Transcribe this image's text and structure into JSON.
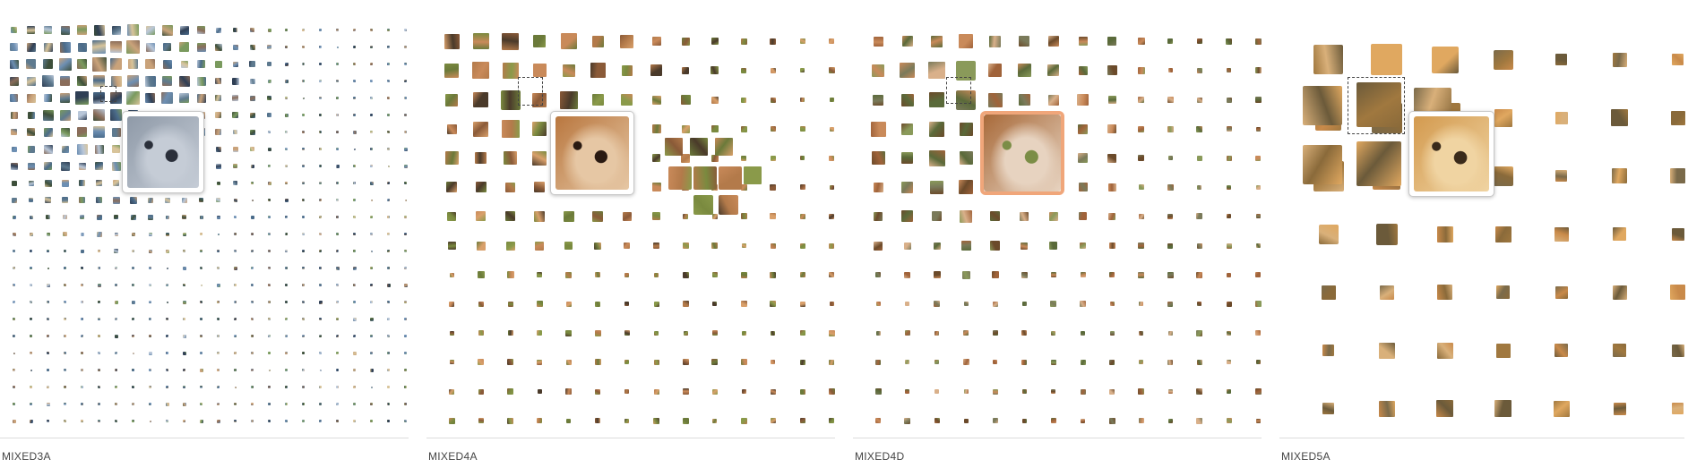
{
  "panels": [
    {
      "label": "MIXED3A",
      "palette": [
        "#4a6b8a",
        "#6d8fb3",
        "#c9a27a",
        "#8a6d5a",
        "#3d4f3a",
        "#7a9a5e",
        "#b9c7d9",
        "#2f3f55",
        "#d8c49a",
        "#5e7a8f"
      ],
      "zoom_colors": [
        "#8f9aa8",
        "#c5ccd6",
        "#2a2f3a"
      ],
      "highlight": false
    },
    {
      "label": "MIXED4A",
      "palette": [
        "#b37a4a",
        "#8a5a38",
        "#d9a06b",
        "#6b7a3a",
        "#8a9a4a",
        "#4a3a2a",
        "#c98a5a",
        "#7a8a3f"
      ],
      "zoom_colors": [
        "#b9773f",
        "#e6c7a4",
        "#2a1a12"
      ],
      "highlight": false
    },
    {
      "label": "MIXED4D",
      "palette": [
        "#a0633a",
        "#c98a5a",
        "#5a6a3a",
        "#8a9a5a",
        "#d9b08a",
        "#6b4a2a",
        "#7a7a5a"
      ],
      "zoom_colors": [
        "#a86a3a",
        "#e7d3c0",
        "#7b8d46"
      ],
      "highlight": true
    },
    {
      "label": "MIXED5A",
      "palette": [
        "#c98a4a",
        "#e0a860",
        "#8a6a3a",
        "#a0783f",
        "#6b5a3a",
        "#d9b07a",
        "#7a6a4a"
      ],
      "zoom_colors": [
        "#d39a4f",
        "#f0d4a2",
        "#3a2a1a"
      ],
      "highlight": false
    }
  ]
}
